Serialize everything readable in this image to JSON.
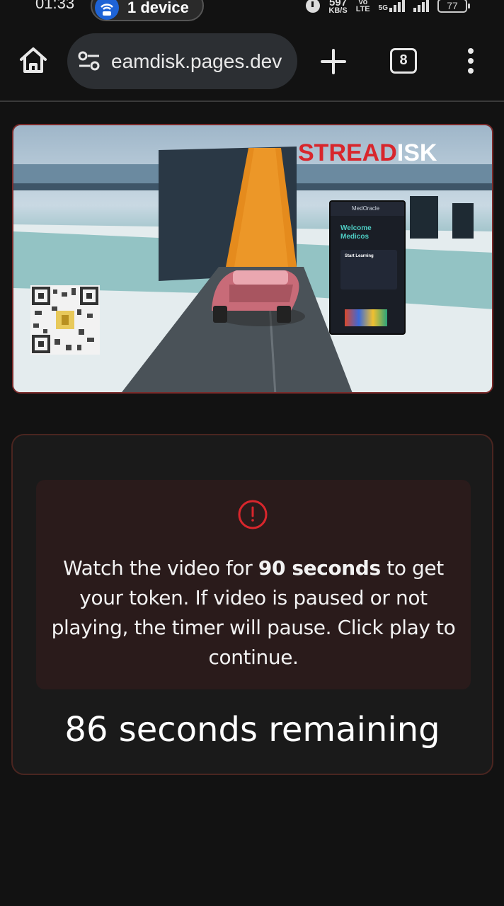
{
  "status_bar": {
    "time": "01:33",
    "hotspot_label": "1 device",
    "net_speed_value": "597",
    "net_speed_unit": "KB/S",
    "volte_top": "Vo",
    "volte_bottom": "LTE",
    "network_5g": "5G",
    "battery": "77"
  },
  "browser": {
    "url": "eamdisk.pages.dev",
    "tab_count": "8"
  },
  "video": {
    "watermark_red": "STREA",
    "watermark_red2": "D",
    "watermark_white": "ISK",
    "phone_app_name": "MedOracle",
    "phone_welcome_line1": "Welcome",
    "phone_welcome_line2": "Medicos",
    "phone_card_title": "Start Learning"
  },
  "timer": {
    "notice_prefix": "Watch the video for ",
    "notice_bold": "90 seconds",
    "notice_suffix": " to get your token. If video is paused or not playing, the timer will pause. Click play to continue.",
    "countdown_text": "86 seconds remaining"
  },
  "colors": {
    "accent_red": "#d8262c",
    "card_border": "#4a2520",
    "notice_bg": "#2a1b1b"
  },
  "icons": {
    "home": "home-icon",
    "site_settings": "tune-icon",
    "new_tab": "plus-icon",
    "tabs": "tab-switcher-icon",
    "menu": "kebab-menu-icon",
    "info": "alert-circle-icon"
  }
}
